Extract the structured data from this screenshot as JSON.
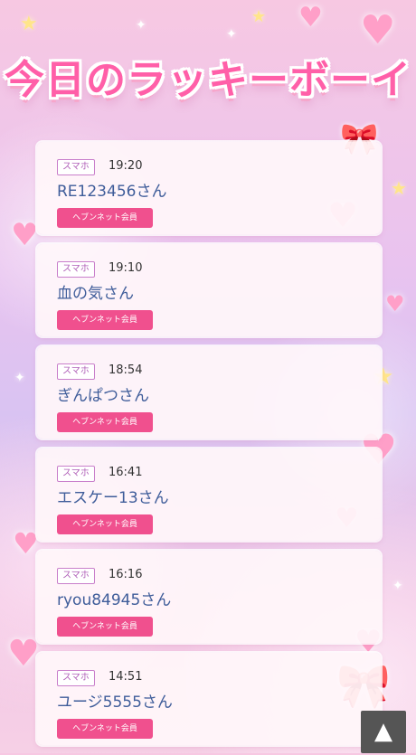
{
  "header": {
    "title": "今日のラッキーボーイ"
  },
  "entries": [
    {
      "device": "スマホ",
      "time": "19:20",
      "name": "RE123456さん",
      "member": "ヘブンネット会員"
    },
    {
      "device": "スマホ",
      "time": "19:10",
      "name": "血の気さん",
      "member": "ヘブンネット会員"
    },
    {
      "device": "スマホ",
      "time": "18:54",
      "name": "ぎんぱつさん",
      "member": "ヘブンネット会員"
    },
    {
      "device": "スマホ",
      "time": "16:41",
      "name": "エスケー13さん",
      "member": "ヘブンネット会員"
    },
    {
      "device": "スマホ",
      "time": "16:16",
      "name": "ryou84945さん",
      "member": "ヘブンネット会員"
    },
    {
      "device": "スマホ",
      "time": "14:51",
      "name": "ユージ5555さん",
      "member": "ヘブンネット会員"
    }
  ],
  "scroll_top": {
    "icon": "triangle-up-icon"
  },
  "colors": {
    "accent": "#f0508e",
    "name_text": "#3f5d9a",
    "title": "#ff5fa8"
  }
}
